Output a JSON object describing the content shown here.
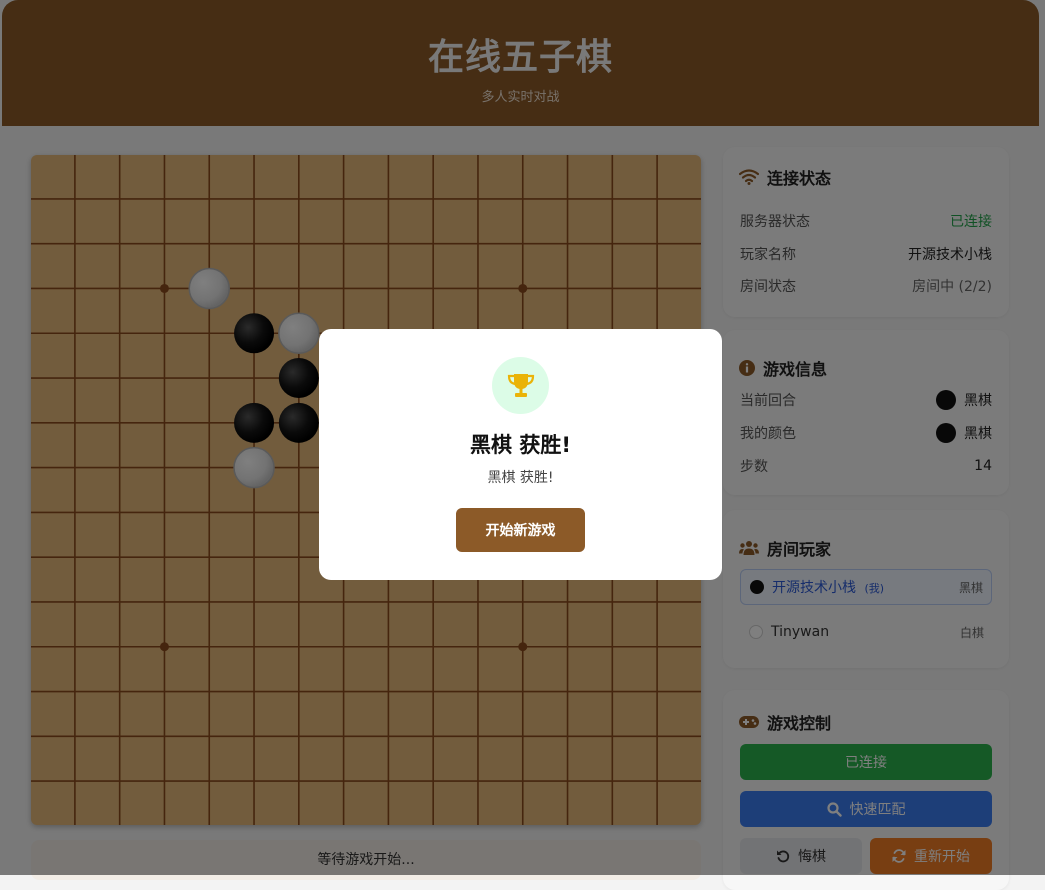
{
  "header": {
    "title": "在线五子棋",
    "subtitle": "多人实时对战"
  },
  "board": {
    "size": 15,
    "colors": {
      "wood": "#e4b87a",
      "line": "#8b4a1c",
      "star": "#8b4a1c"
    },
    "star_points": [
      [
        3,
        3
      ],
      [
        11,
        3
      ],
      [
        3,
        11
      ],
      [
        11,
        11
      ]
    ],
    "stones": [
      {
        "col": 4,
        "row": 3,
        "color": "white"
      },
      {
        "col": 5,
        "row": 4,
        "color": "black"
      },
      {
        "col": 6,
        "row": 4,
        "color": "white"
      },
      {
        "col": 6,
        "row": 5,
        "color": "black"
      },
      {
        "col": 5,
        "row": 6,
        "color": "black"
      },
      {
        "col": 6,
        "row": 6,
        "color": "black"
      },
      {
        "col": 5,
        "row": 7,
        "color": "white"
      }
    ]
  },
  "status_bar": {
    "text": "等待游戏开始..."
  },
  "connection": {
    "title": "连接状态",
    "icon": "wifi-icon",
    "rows": [
      {
        "label": "服务器状态",
        "value": "已连接"
      },
      {
        "label": "玩家名称",
        "value": "开源技术小栈"
      },
      {
        "label": "房间状态",
        "value": "房间中 (2/2)"
      }
    ]
  },
  "game_info": {
    "title": "游戏信息",
    "icon": "info-icon",
    "current_turn_label": "当前回合",
    "current_turn_value": "黑棋",
    "my_color_label": "我的颜色",
    "my_color_value": "黑棋",
    "steps_label": "步数",
    "steps_value": "14"
  },
  "room_players": {
    "title": "房间玩家",
    "icon": "users-icon",
    "players": [
      {
        "name": "开源技术小栈",
        "tag": "(我)",
        "color_label": "黑棋",
        "stone": "black"
      },
      {
        "name": "Tinywan",
        "tag": "",
        "color_label": "白棋",
        "stone": "white"
      }
    ]
  },
  "controls": {
    "title": "游戏控制",
    "icon": "gamepad-icon",
    "connected_label": "已连接",
    "match_label": "快速匹配",
    "undo_label": "悔棋",
    "restart_label": "重新开始"
  },
  "modal": {
    "title": "黑棋 获胜!",
    "message": "黑棋 获胜!",
    "button_label": "开始新游戏",
    "icon": "trophy-icon"
  }
}
